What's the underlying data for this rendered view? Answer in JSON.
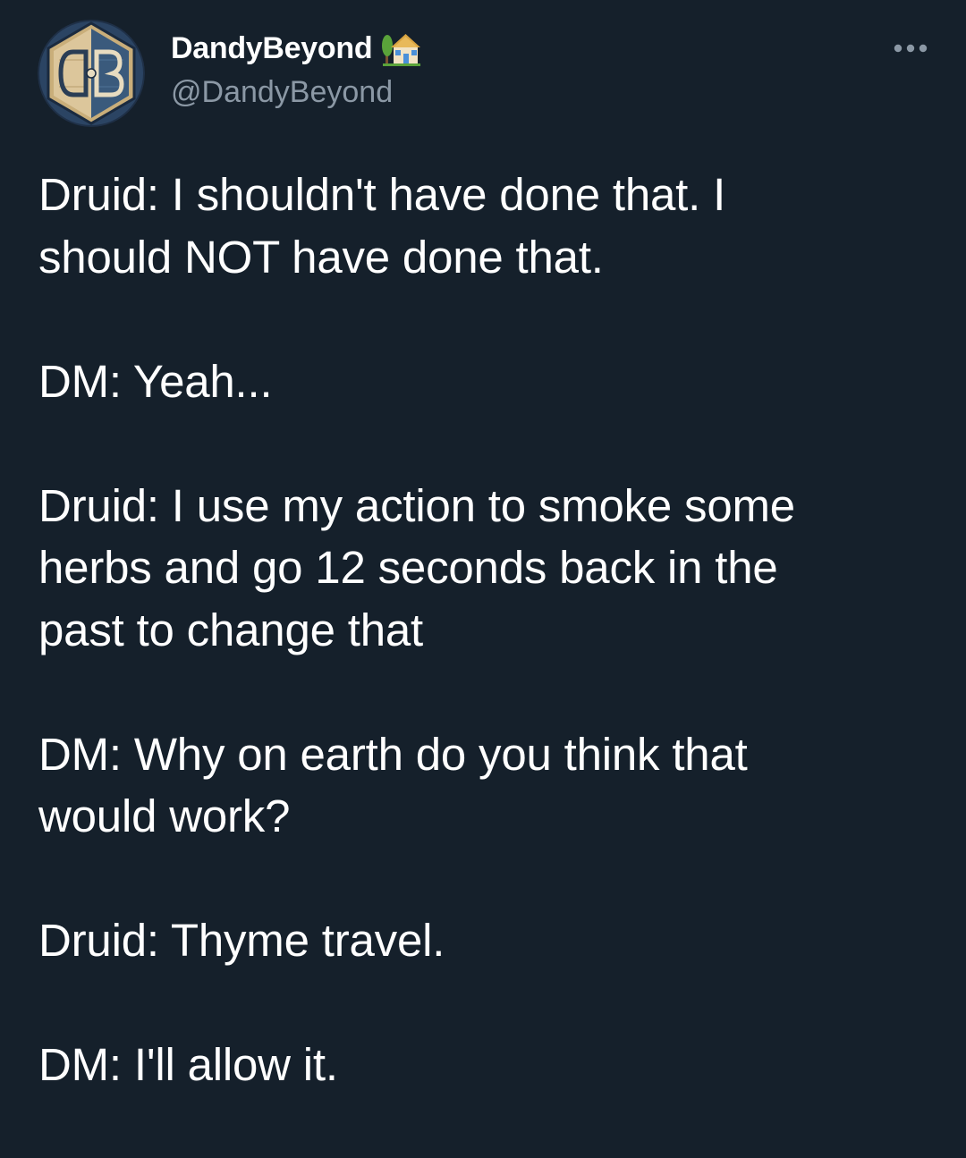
{
  "tweet": {
    "author": {
      "display_name": "DandyBeyond",
      "handle": "@DandyBeyond",
      "avatar_monogram": "DB",
      "name_emoji": "house-with-garden-icon"
    },
    "more_icon": "more-options-icon",
    "paragraphs": [
      "Druid: I shouldn't have done that. I\nshould NOT have done that.",
      "DM: Yeah...",
      "Druid: I use my action to smoke some\nherbs and go 12 seconds back in the\npast to change that",
      "DM: Why on earth do you think that\nwould work?",
      "Druid: Thyme travel.",
      "DM: I'll allow it."
    ]
  },
  "colors": {
    "background": "#15202b",
    "text_primary": "#ffffff",
    "text_secondary": "#8b98a5",
    "avatar_parchment": "#d9c49a",
    "avatar_blue": "#2f4e6e"
  }
}
